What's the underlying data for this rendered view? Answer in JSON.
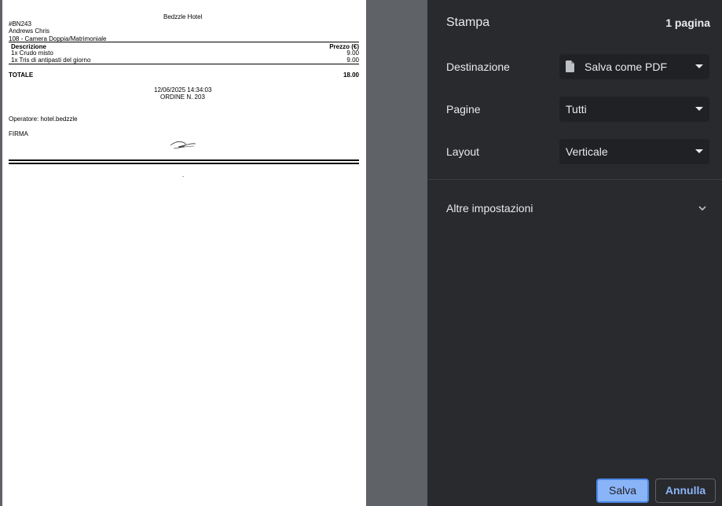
{
  "receipt": {
    "hotel_name": "Bedzzle Hotel",
    "booking_code": "#BN243",
    "guest_name": "Andrews Chris",
    "room": "108 - Camera Doppia/Matrimoniale",
    "col_description": "Descrizione",
    "col_price": "Prezzo (€)",
    "items": [
      {
        "description": "1x Crudo misto",
        "price": "9.00"
      },
      {
        "description": "1x Tris di antipasti del giorno",
        "price": "9.00"
      }
    ],
    "total_label": "TOTALE",
    "total_value": "18.00",
    "datetime": "12/06/2025 14:34:03",
    "order": "ORDINE N. 203",
    "operator": "Operatore: hotel.bedzzle",
    "signature_label": "FIRMA",
    "footer_dot": "."
  },
  "panel": {
    "title": "Stampa",
    "page_count": "1 pagina",
    "destination_label": "Destinazione",
    "destination_value": "Salva come PDF",
    "pages_label": "Pagine",
    "pages_value": "Tutti",
    "layout_label": "Layout",
    "layout_value": "Verticale",
    "more_settings": "Altre impostazioni",
    "save_button": "Salva",
    "cancel_button": "Annulla"
  },
  "icons": {
    "document": "document-icon",
    "dropdown": "caret-down-icon",
    "expand": "chevron-down-icon"
  },
  "colors": {
    "panel_bg": "#292a2d",
    "select_bg": "#202124",
    "preview_bg": "#5f6368",
    "accent": "#8ab4f8"
  }
}
